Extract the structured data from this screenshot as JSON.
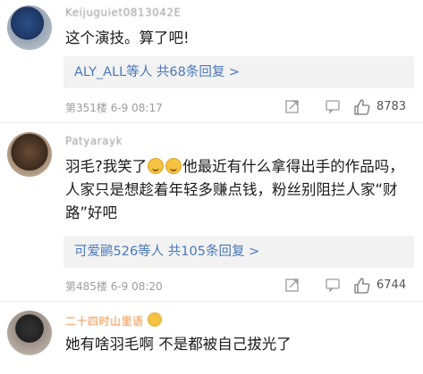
{
  "comments": [
    {
      "username": "Keijuguiet0813042E",
      "text": "这个演技。算了吧!",
      "reply_link": "ALY_ALL等人 共68条回复 >",
      "floor": "第351楼 6-9 08:17",
      "likes": "8783"
    },
    {
      "username": "Patyarayk",
      "text_parts": [
        "羽毛?我笑了",
        "他最近有什么拿得出手的作品吗，人家只是想趁着年轻多赚点钱，粉丝别阻拦人家“财路”好吧"
      ],
      "reply_link": "可爱鹂526等人 共105条回复 >",
      "floor": "第485楼 6-9 08:20",
      "likes": "6744"
    },
    {
      "username": "二十四时山里语",
      "text": "她有啥羽毛啊 不是都被自己拔光了"
    }
  ],
  "icons": {
    "share": "share-icon",
    "comment": "comment-icon",
    "like": "thumbs-up-icon",
    "emoji": "laughing-emoji-icon"
  },
  "colors": {
    "link": "#4a78b9",
    "meta": "#9c9c9c",
    "reply_bg": "#f2f2f2",
    "highlight_name": "#e98a3b"
  }
}
